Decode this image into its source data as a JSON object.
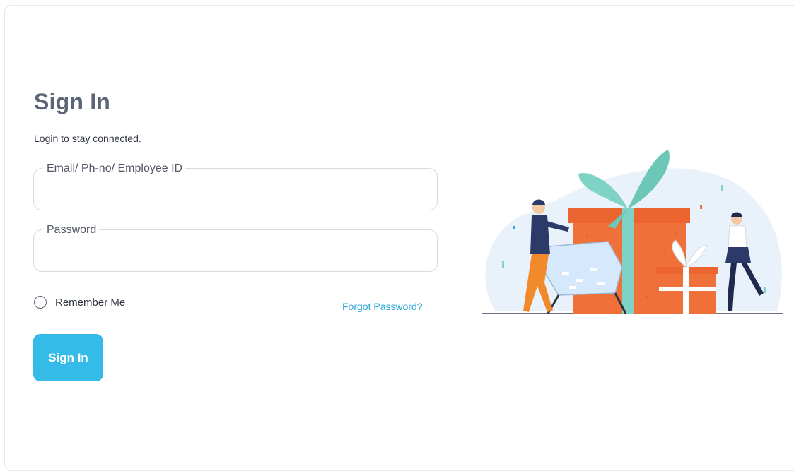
{
  "signin": {
    "title": "Sign In",
    "subtitle": "Login to stay connected.",
    "fields": [
      {
        "label": "Email/ Ph-no/ Employee ID",
        "value": "",
        "placeholder": ""
      },
      {
        "label": "Password",
        "value": "",
        "placeholder": ""
      }
    ],
    "remember_label": "Remember Me",
    "remember_checked": false,
    "forgot_label": "Forgot Password?",
    "button_label": "Sign In"
  },
  "colors": {
    "primary": "#35bbe8",
    "link": "#2aa8d8",
    "title": "#5c6477",
    "gift": "#f0703a",
    "ribbon": "#7fd3c4"
  }
}
